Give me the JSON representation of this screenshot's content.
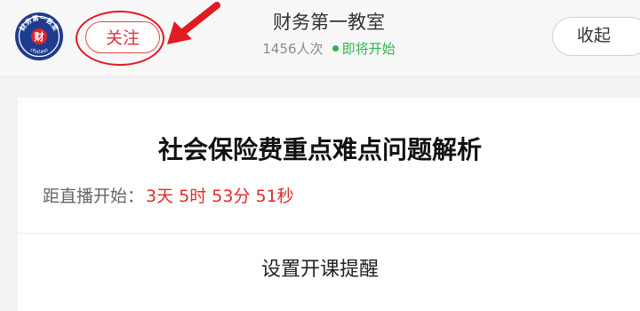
{
  "header": {
    "logo_icon": "caiwu-diyi-jiaoshi-logo",
    "logo_text": "财务第一教室 cfoclass 财",
    "follow_label": "关注",
    "title": "财务第一教室",
    "viewers": "1456人次",
    "status": "即将开始",
    "collapse_label": "收起"
  },
  "course": {
    "title": "社会保险费重点难点问题解析",
    "countdown_label": "距直播开始：",
    "countdown_value": "3天 5时 53分 51秒",
    "remind_label": "设置开课提醒"
  },
  "colors": {
    "accent_red": "#e02a2a",
    "live_green": "#2fb34f",
    "logo_blue": "#1d3c8f"
  }
}
